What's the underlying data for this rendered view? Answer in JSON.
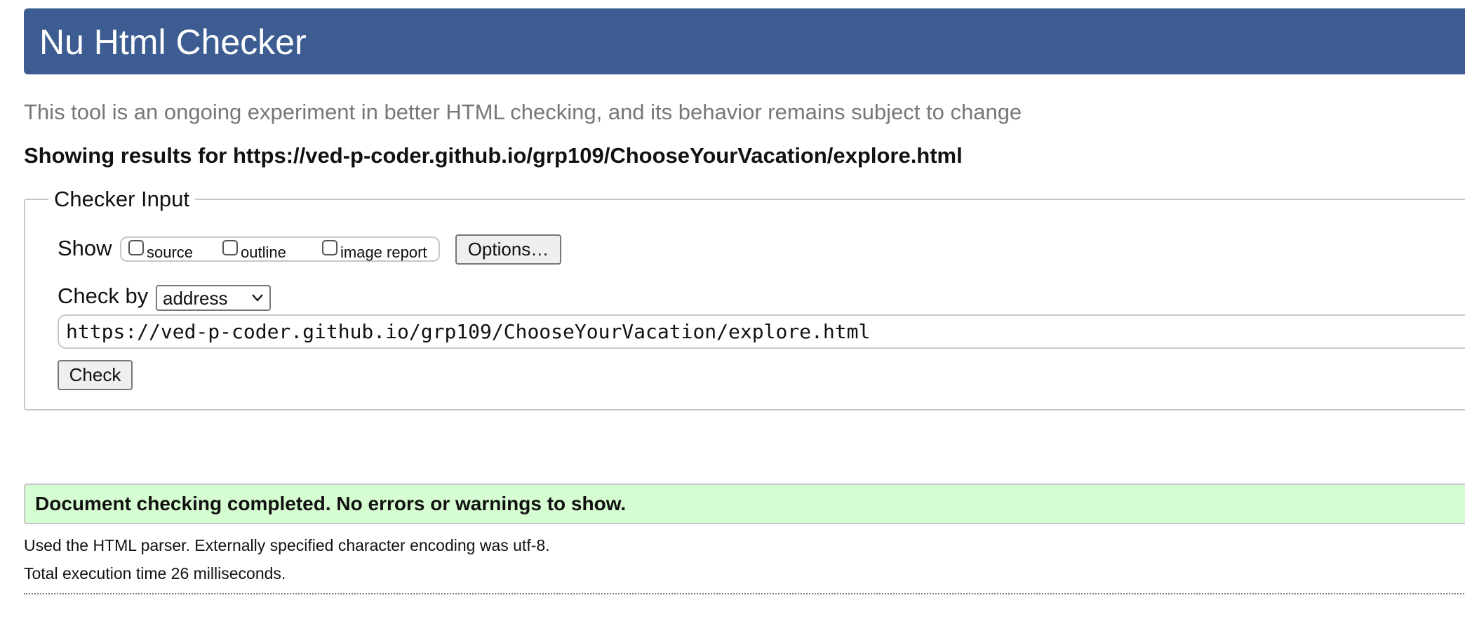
{
  "header": {
    "title": "Nu Html Checker",
    "banner_color": "#3d5d92"
  },
  "tagline": "This tool is an ongoing experiment in better HTML checking, and its behavior remains subject to change",
  "results_heading": "Showing results for https://ved-p-coder.github.io/grp109/ChooseYourVacation/explore.html",
  "checker_input": {
    "legend": "Checker Input",
    "show_label": "Show",
    "show_options": [
      {
        "label": "source",
        "checked": false
      },
      {
        "label": "outline",
        "checked": false
      },
      {
        "label": "image report",
        "checked": false
      }
    ],
    "options_button": "Options…",
    "check_by_label": "Check by",
    "check_by_selected": "address",
    "url_value": "https://ved-p-coder.github.io/grp109/ChooseYourVacation/explore.html",
    "check_button": "Check"
  },
  "result": {
    "message": "Document checking completed. No errors or warnings to show.",
    "background_color": "#d6fdd1"
  },
  "info": {
    "parser_line": "Used the HTML parser. Externally specified character encoding was utf-8.",
    "timing_line": "Total execution time 26 milliseconds."
  },
  "icons": {
    "select_chevron": "chevron-down-icon"
  }
}
